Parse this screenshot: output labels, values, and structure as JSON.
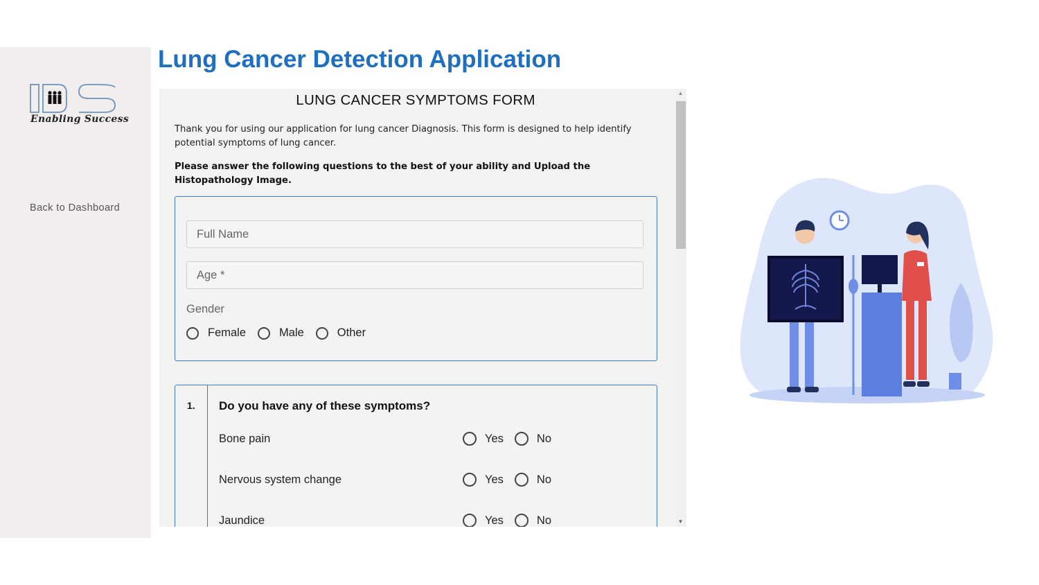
{
  "sidebar": {
    "logo_text": "IDS",
    "logo_tagline": "Enabling Success",
    "back_link": "Back to Dashboard"
  },
  "app_title": "Lung Cancer Detection Application",
  "form": {
    "heading": "LUNG CANCER SYMPTOMS FORM",
    "intro": "Thank you for using our application for lung cancer Diagnosis. This form is designed to help identify potential symptoms of lung cancer.",
    "instruction": "Please answer the following questions to the best of your ability and Upload the Histopathology Image.",
    "full_name_placeholder": "Full Name",
    "age_placeholder": "Age *",
    "gender_label": "Gender",
    "gender_options": [
      "Female",
      "Male",
      "Other"
    ],
    "question": {
      "number": "1.",
      "title": "Do you have any of these symptoms?",
      "yes_label": "Yes",
      "no_label": "No",
      "symptoms": [
        "Bone pain",
        "Nervous system change",
        "Jaundice"
      ]
    }
  },
  "colors": {
    "title_blue": "#1f6fc0",
    "border_blue": "#3a7ac8",
    "sidebar_bg": "#f2eeee",
    "form_bg": "#f5f2f2"
  },
  "illustration": "doctor-xray-illustration"
}
